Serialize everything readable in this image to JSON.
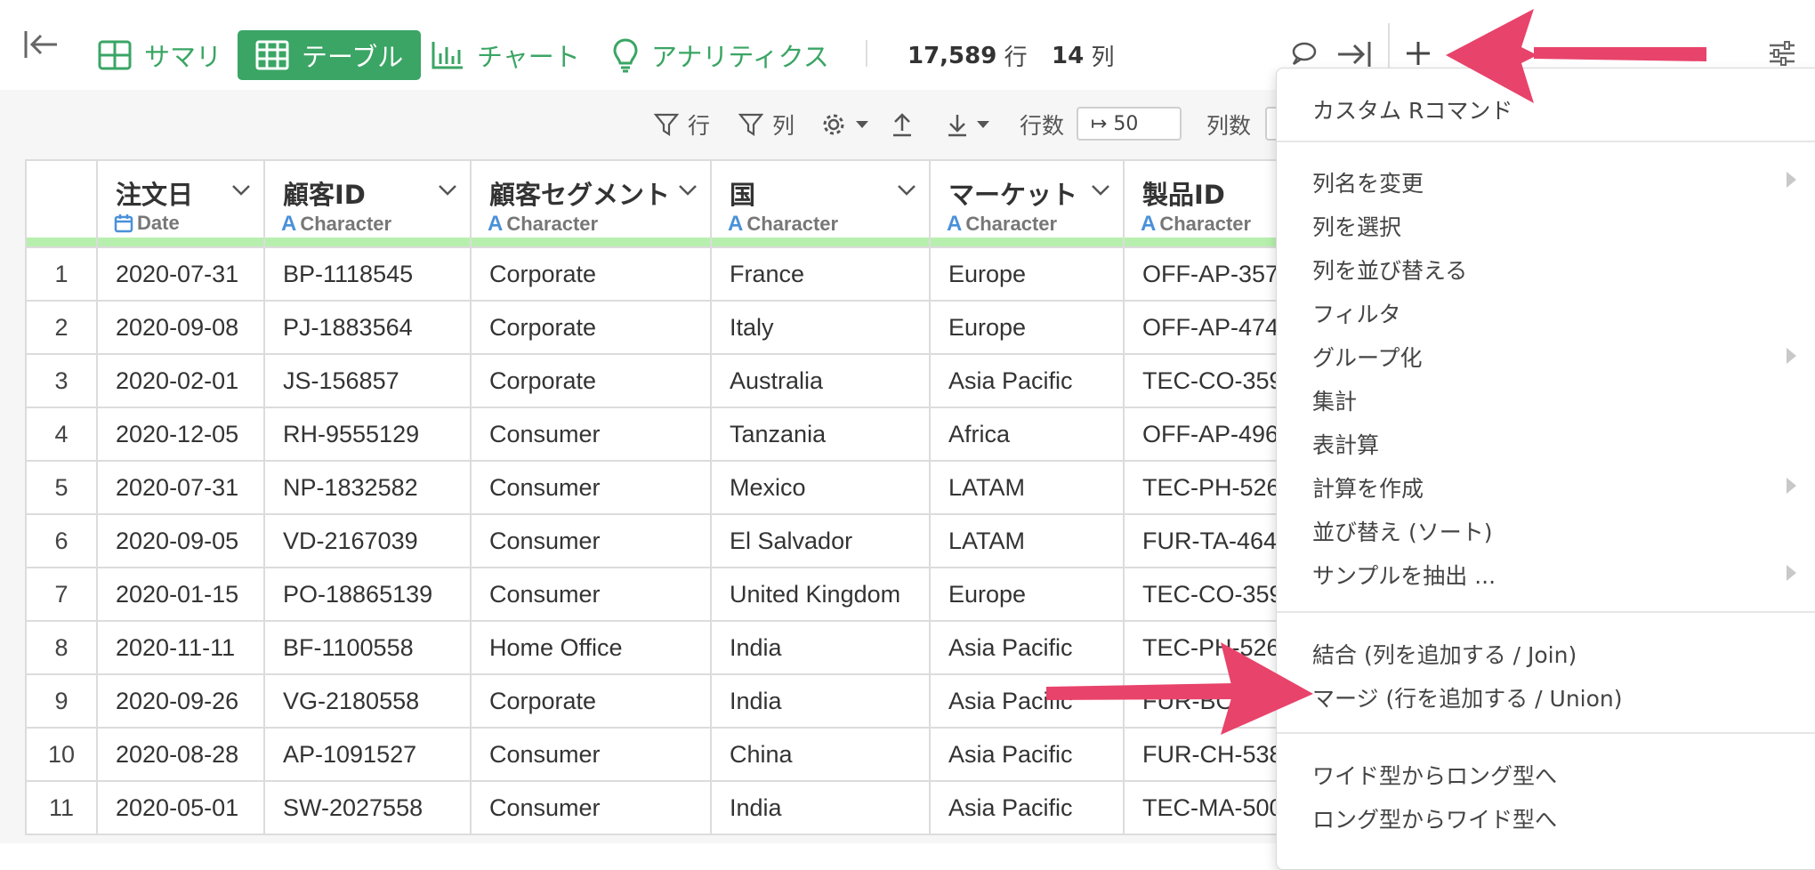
{
  "toolbar": {
    "nav": [
      {
        "label": "サマリ",
        "icon": "summary-grid-icon"
      },
      {
        "label": "テーブル",
        "icon": "table-icon",
        "active": true
      },
      {
        "label": "チャート",
        "icon": "bar-chart-icon"
      },
      {
        "label": "アナリティクス",
        "icon": "lightbulb-icon"
      }
    ],
    "rows_count": "17,589",
    "rows_unit": "行",
    "cols_count": "14",
    "cols_unit": "列"
  },
  "subtoolbar": {
    "filter_row_label": "行",
    "filter_col_label": "列",
    "rows_label": "行数",
    "rows_value": "↦ 50",
    "cols_label": "列数"
  },
  "columns": [
    {
      "name": "注文日",
      "type": "Date",
      "icon": "calendar-icon"
    },
    {
      "name": "顧客ID",
      "type": "Character",
      "icon": "character-type-icon"
    },
    {
      "name": "顧客セグメント",
      "type": "Character",
      "icon": "character-type-icon"
    },
    {
      "name": "国",
      "type": "Character",
      "icon": "character-type-icon"
    },
    {
      "name": "マーケット",
      "type": "Character",
      "icon": "character-type-icon"
    },
    {
      "name": "製品ID",
      "type": "Character",
      "icon": "character-type-icon"
    }
  ],
  "rows": [
    [
      "1",
      "2020-07-31",
      "BP-1118545",
      "Corporate",
      "France",
      "Europe",
      "OFF-AP-357"
    ],
    [
      "2",
      "2020-09-08",
      "PJ-1883564",
      "Corporate",
      "Italy",
      "Europe",
      "OFF-AP-474"
    ],
    [
      "3",
      "2020-02-01",
      "JS-156857",
      "Corporate",
      "Australia",
      "Asia Pacific",
      "TEC-CO-359"
    ],
    [
      "4",
      "2020-12-05",
      "RH-9555129",
      "Consumer",
      "Tanzania",
      "Africa",
      "OFF-AP-496"
    ],
    [
      "5",
      "2020-07-31",
      "NP-1832582",
      "Consumer",
      "Mexico",
      "LATAM",
      "TEC-PH-526"
    ],
    [
      "6",
      "2020-09-05",
      "VD-2167039",
      "Consumer",
      "El Salvador",
      "LATAM",
      "FUR-TA-464"
    ],
    [
      "7",
      "2020-01-15",
      "PO-18865139",
      "Consumer",
      "United Kingdom",
      "Europe",
      "TEC-CO-359"
    ],
    [
      "8",
      "2020-11-11",
      "BF-1100558",
      "Home Office",
      "India",
      "Asia Pacific",
      "TEC-PH-526"
    ],
    [
      "9",
      "2020-09-26",
      "VG-2180558",
      "Corporate",
      "India",
      "Asia Pacific",
      "FUR-BO-"
    ],
    [
      "10",
      "2020-08-28",
      "AP-1091527",
      "Consumer",
      "China",
      "Asia Pacific",
      "FUR-CH-538"
    ],
    [
      "11",
      "2020-05-01",
      "SW-2027558",
      "Consumer",
      "India",
      "Asia Pacific",
      "TEC-MA-500"
    ]
  ],
  "menu": {
    "items": [
      {
        "label": "カスタム Rコマンド",
        "submenu": false
      },
      {
        "label": "列名を変更",
        "submenu": true
      },
      {
        "label": "列を選択",
        "submenu": false
      },
      {
        "label": "列を並び替える",
        "submenu": false
      },
      {
        "label": "フィルタ",
        "submenu": false
      },
      {
        "label": "グループ化",
        "submenu": true
      },
      {
        "label": "集計",
        "submenu": false
      },
      {
        "label": "表計算",
        "submenu": false
      },
      {
        "label": "計算を作成",
        "submenu": true
      },
      {
        "label": "並び替え (ソート)",
        "submenu": false
      },
      {
        "label": "サンプルを抽出 ...",
        "submenu": true
      },
      {
        "label": "結合 (列を追加する / Join)",
        "submenu": false
      },
      {
        "label": "マージ (行を追加する / Union)",
        "submenu": false
      },
      {
        "label": "ワイド型からロング型へ",
        "submenu": false
      },
      {
        "label": "ロング型からワイド型へ",
        "submenu": false
      }
    ]
  },
  "colors": {
    "accent": "#3aa564",
    "annotation_arrow": "#e8436b",
    "header_strip": "#b7f0ae"
  }
}
